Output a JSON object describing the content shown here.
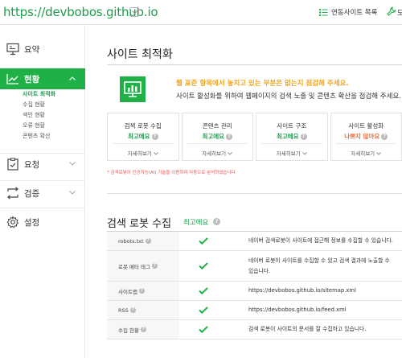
{
  "header": {
    "site_url": "https://devbobos.github.io",
    "link_label": "연동사이트 목록",
    "cut_label": "도"
  },
  "sidebar": {
    "items": [
      {
        "label": "요약",
        "icon": "presentation-board-icon"
      },
      {
        "label": "현황",
        "icon": "trend-chart-icon",
        "active": true
      },
      {
        "label": "요청",
        "icon": "clipboard-check-icon"
      },
      {
        "label": "검증",
        "icon": "swap-arrows-icon"
      },
      {
        "label": "설정",
        "icon": "gear-icon"
      }
    ],
    "sub_items": [
      "사이트 최적화",
      "수집 현황",
      "색인 현황",
      "오류 현황",
      "콘텐츠 확산"
    ]
  },
  "main": {
    "title": "사이트 최적화",
    "banner": {
      "line1": "웹 표준 항목에서 놓치고 있는 부분은 없는지 점검해 주세요.",
      "line2": "사이트 활성화를 위하여 웹페이지의 검색 노출 및 콘텐츠 확산을 점검해 주세요."
    },
    "cards": [
      {
        "title": "검색 로봇 수집",
        "status": "최고에요",
        "more": "자세히보기"
      },
      {
        "title": "콘텐츠 관리",
        "status": "최고에요",
        "more": "자세히보기"
      },
      {
        "title": "사이트 구조",
        "status": "최고에요",
        "more": "자세히보기"
      },
      {
        "title": "사이트 활성화",
        "status": "나쁘지 않아요",
        "more": "자세히보기"
      }
    ],
    "note": "* 검색로봇이 인공지능(AI) 기술을 이용하여 자동으로 분석하였습니다",
    "section2": {
      "title": "검색 로봇 수집",
      "status": "최고에요"
    },
    "rows": [
      {
        "name": "robots.txt",
        "desc": "네이버 검색로봇이 사이트에 접근해 정보를 수집할 수 있습니다."
      },
      {
        "name": "로봇 메타 태그",
        "desc": "네이버 로봇이 사이트를 수집할 수 있고 검색 결과에 노출할 수 있습니다."
      },
      {
        "name": "사이트맵",
        "desc": "https://devbobos.github.io/sitemap.xml"
      },
      {
        "name": "RSS",
        "desc": "https://devbobos.github.io/feed.xml"
      },
      {
        "name": "수집 현황",
        "desc": "검색 로봇이 사이트의 문서를 잘 수집하고 있습니다."
      }
    ]
  },
  "colors": {
    "brand_green": "#1fb148",
    "warn_orange": "#f06b35",
    "banner_yellow": "#f0a51e",
    "note_red": "#f04f4f"
  }
}
